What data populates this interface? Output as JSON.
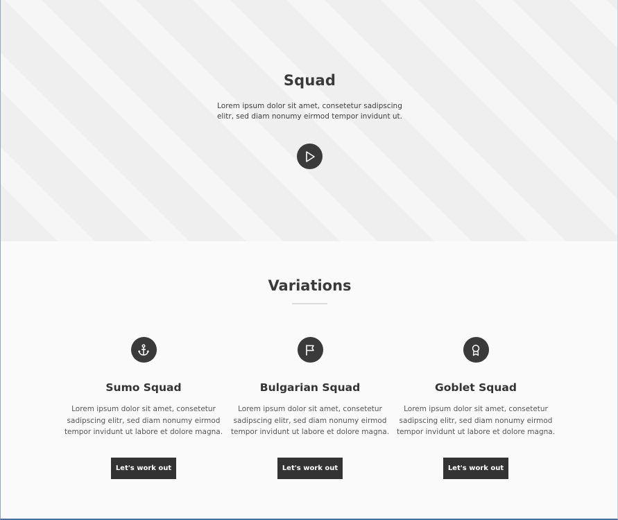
{
  "hero": {
    "title": "Squad",
    "text_line1": "Lorem ipsum dolor sit amet, consetetur sadipscing",
    "text_line2": "elitr, sed diam nonumy eirmod tempor invidunt ut.",
    "play_icon": "play-icon"
  },
  "variations": {
    "title": "Variations",
    "cards": [
      {
        "icon": "anchor-icon",
        "title": "Sumo Squad",
        "text_line1": "Lorem ipsum dolor sit amet, consetetur",
        "text_line2": "sadipscing elitr, sed diam nonumy eirmod",
        "text_line3": "tempor invidunt ut labore et dolore magna.",
        "button": "Let's work out"
      },
      {
        "icon": "flag-icon",
        "title": "Bulgarian Squad",
        "text_line1": "Lorem ipsum dolor sit amet, consetetur",
        "text_line2": "sadipscing elitr, sed diam nonumy eirmod",
        "text_line3": "tempor invidunt ut labore et dolore magna.",
        "button": "Let's work out"
      },
      {
        "icon": "award-icon",
        "title": "Goblet Squad",
        "text_line1": "Lorem ipsum dolor sit amet, consetetur",
        "text_line2": "sadipscing elitr, sed diam nonumy eirmod",
        "text_line3": "tempor invidunt ut labore et dolore magna.",
        "button": "Let's work out"
      }
    ]
  },
  "colors": {
    "dark": "#333333",
    "hero_bg": "#efefef",
    "stripe": "#f6f6f6"
  }
}
